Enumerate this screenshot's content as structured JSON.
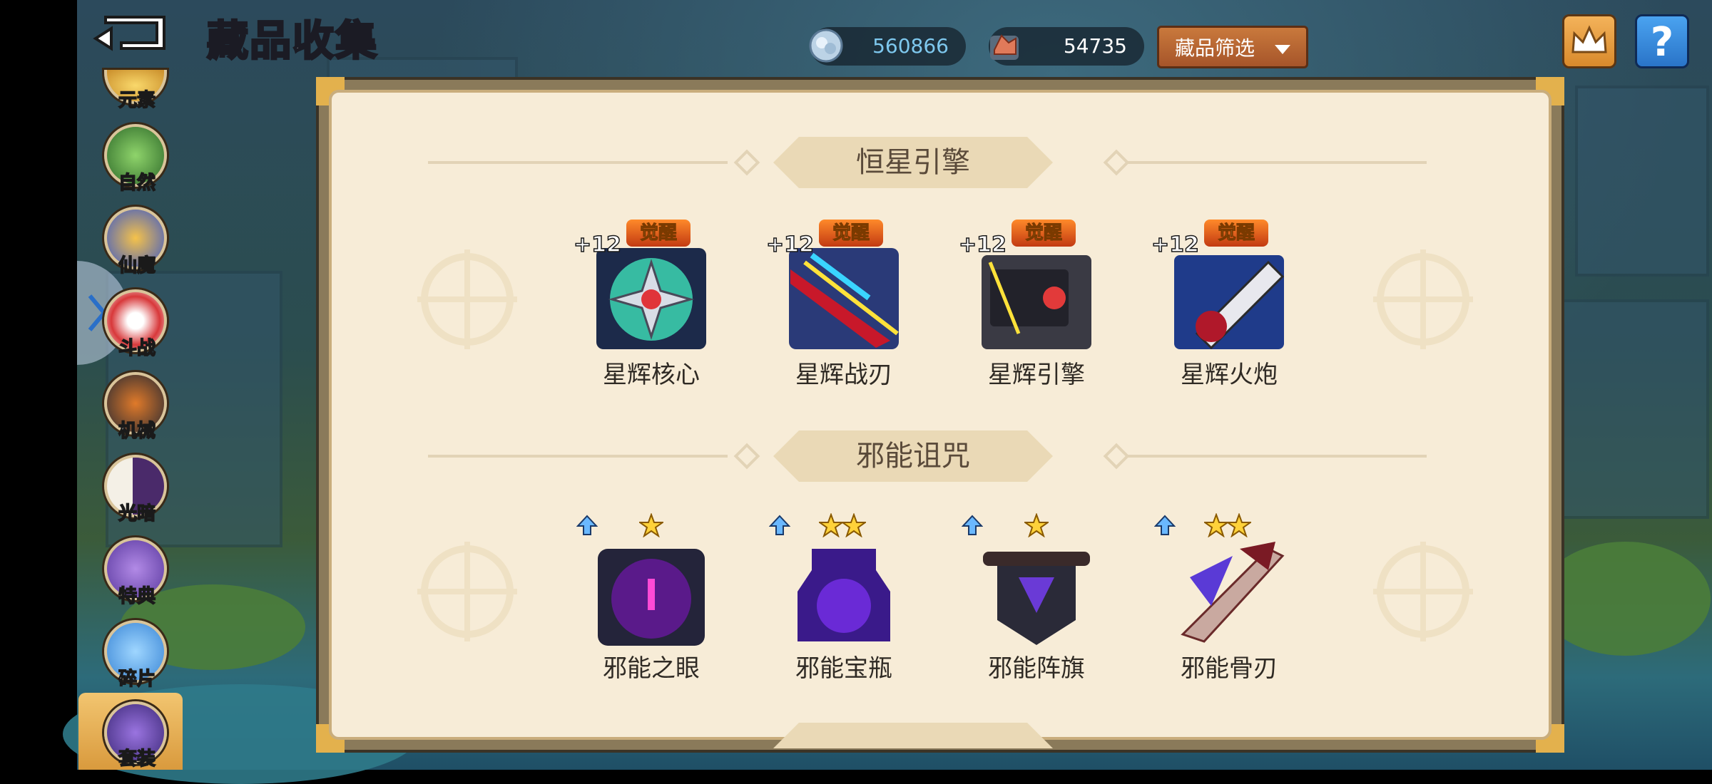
{
  "header": {
    "title": "藏品收集",
    "currencies": [
      {
        "icon": "crystal-coin-icon",
        "value": "560866",
        "color": "#7ec8ee"
      },
      {
        "icon": "ore-icon",
        "value": "54735",
        "color": "#ffffff"
      }
    ],
    "filter_label": "藏品筛选"
  },
  "sidebar": {
    "items": [
      {
        "label": "元素",
        "icon": "element-icon"
      },
      {
        "label": "自然",
        "icon": "nature-icon"
      },
      {
        "label": "仙魔",
        "icon": "immortal-demon-icon"
      },
      {
        "label": "斗战",
        "icon": "battle-icon"
      },
      {
        "label": "机械",
        "icon": "mech-icon"
      },
      {
        "label": "光暗",
        "icon": "light-dark-icon"
      },
      {
        "label": "特典",
        "icon": "special-icon"
      },
      {
        "label": "碎片",
        "icon": "fragment-icon"
      },
      {
        "label": "套装",
        "icon": "set-icon",
        "active": true
      }
    ]
  },
  "sections": [
    {
      "title": "恒星引擎",
      "items": [
        {
          "name": "星辉核心",
          "level": "+12",
          "badge": "觉醒",
          "icon": "star-core-icon"
        },
        {
          "name": "星辉战刃",
          "level": "+12",
          "badge": "觉醒",
          "icon": "star-blade-icon"
        },
        {
          "name": "星辉引擎",
          "level": "+12",
          "badge": "觉醒",
          "icon": "star-engine-icon"
        },
        {
          "name": "星辉火炮",
          "level": "+12",
          "badge": "觉醒",
          "icon": "star-cannon-icon"
        }
      ]
    },
    {
      "title": "邪能诅咒",
      "items": [
        {
          "name": "邪能之眼",
          "stars": 1,
          "upgradable": true,
          "icon": "fel-eye-icon"
        },
        {
          "name": "邪能宝瓶",
          "stars": 2,
          "upgradable": true,
          "icon": "fel-vase-icon"
        },
        {
          "name": "邪能阵旗",
          "stars": 1,
          "upgradable": true,
          "icon": "fel-banner-icon"
        },
        {
          "name": "邪能骨刃",
          "stars": 2,
          "upgradable": true,
          "icon": "fel-bone-blade-icon"
        }
      ]
    }
  ]
}
